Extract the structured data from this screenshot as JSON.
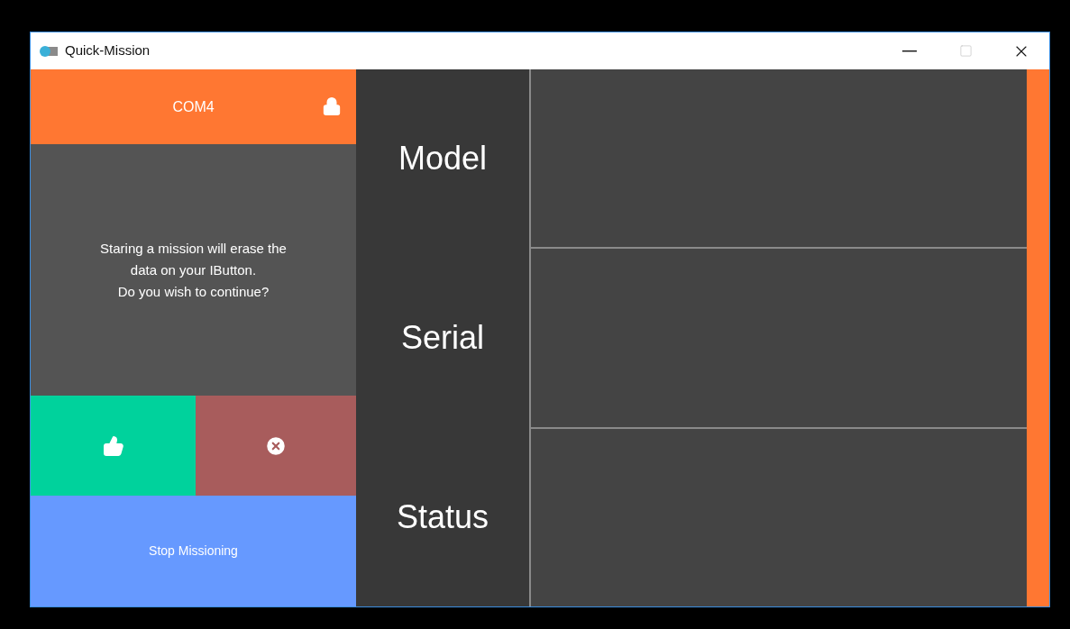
{
  "window": {
    "title": "Quick-Mission"
  },
  "port": {
    "label": "COM4",
    "locked": true
  },
  "message": "Staring a mission will erase the\ndata on your IButton.\nDo you wish to continue?",
  "fields": [
    {
      "label": "Model"
    },
    {
      "label": "Serial"
    },
    {
      "label": "Status"
    }
  ],
  "stop_button": "Stop Missioning"
}
